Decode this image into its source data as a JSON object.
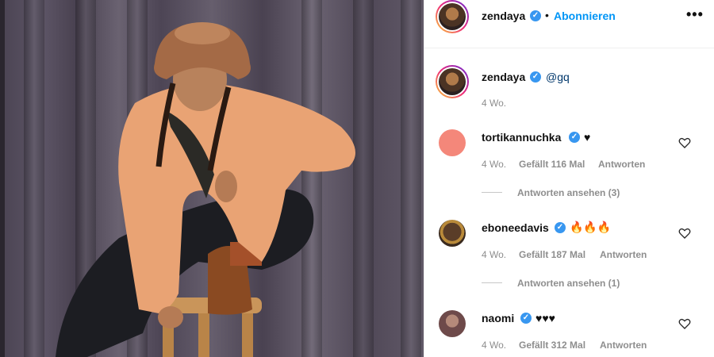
{
  "post": {
    "author": "zendaya",
    "follow_label": "Abonnieren",
    "separator": "•",
    "more_icon": "more-horizontal-icon"
  },
  "caption": {
    "author": "zendaya",
    "text": "@gq",
    "age": "4 Wo."
  },
  "comments": [
    {
      "author": "tortikannuchka",
      "text": "♥",
      "age": "4 Wo.",
      "likes": "Gefällt 116 Mal",
      "reply_label": "Antworten",
      "view_replies": "Antworten ansehen (3)",
      "avatar_color": "#f4877a"
    },
    {
      "author": "eboneedavis",
      "text": "🔥🔥🔥",
      "age": "4 Wo.",
      "likes": "Gefällt 187 Mal",
      "reply_label": "Antworten",
      "view_replies": "Antworten ansehen (1)",
      "avatar_color": "#3a2a1e"
    },
    {
      "author": "naomi",
      "text": "♥♥♥",
      "age": "4 Wo.",
      "likes": "Gefällt 312 Mal",
      "reply_label": "Antworten",
      "avatar_color": "#6e4a4a"
    }
  ],
  "colors": {
    "accent": "#0095f6",
    "verified": "#3897f0",
    "muted": "#8e8e8e"
  }
}
